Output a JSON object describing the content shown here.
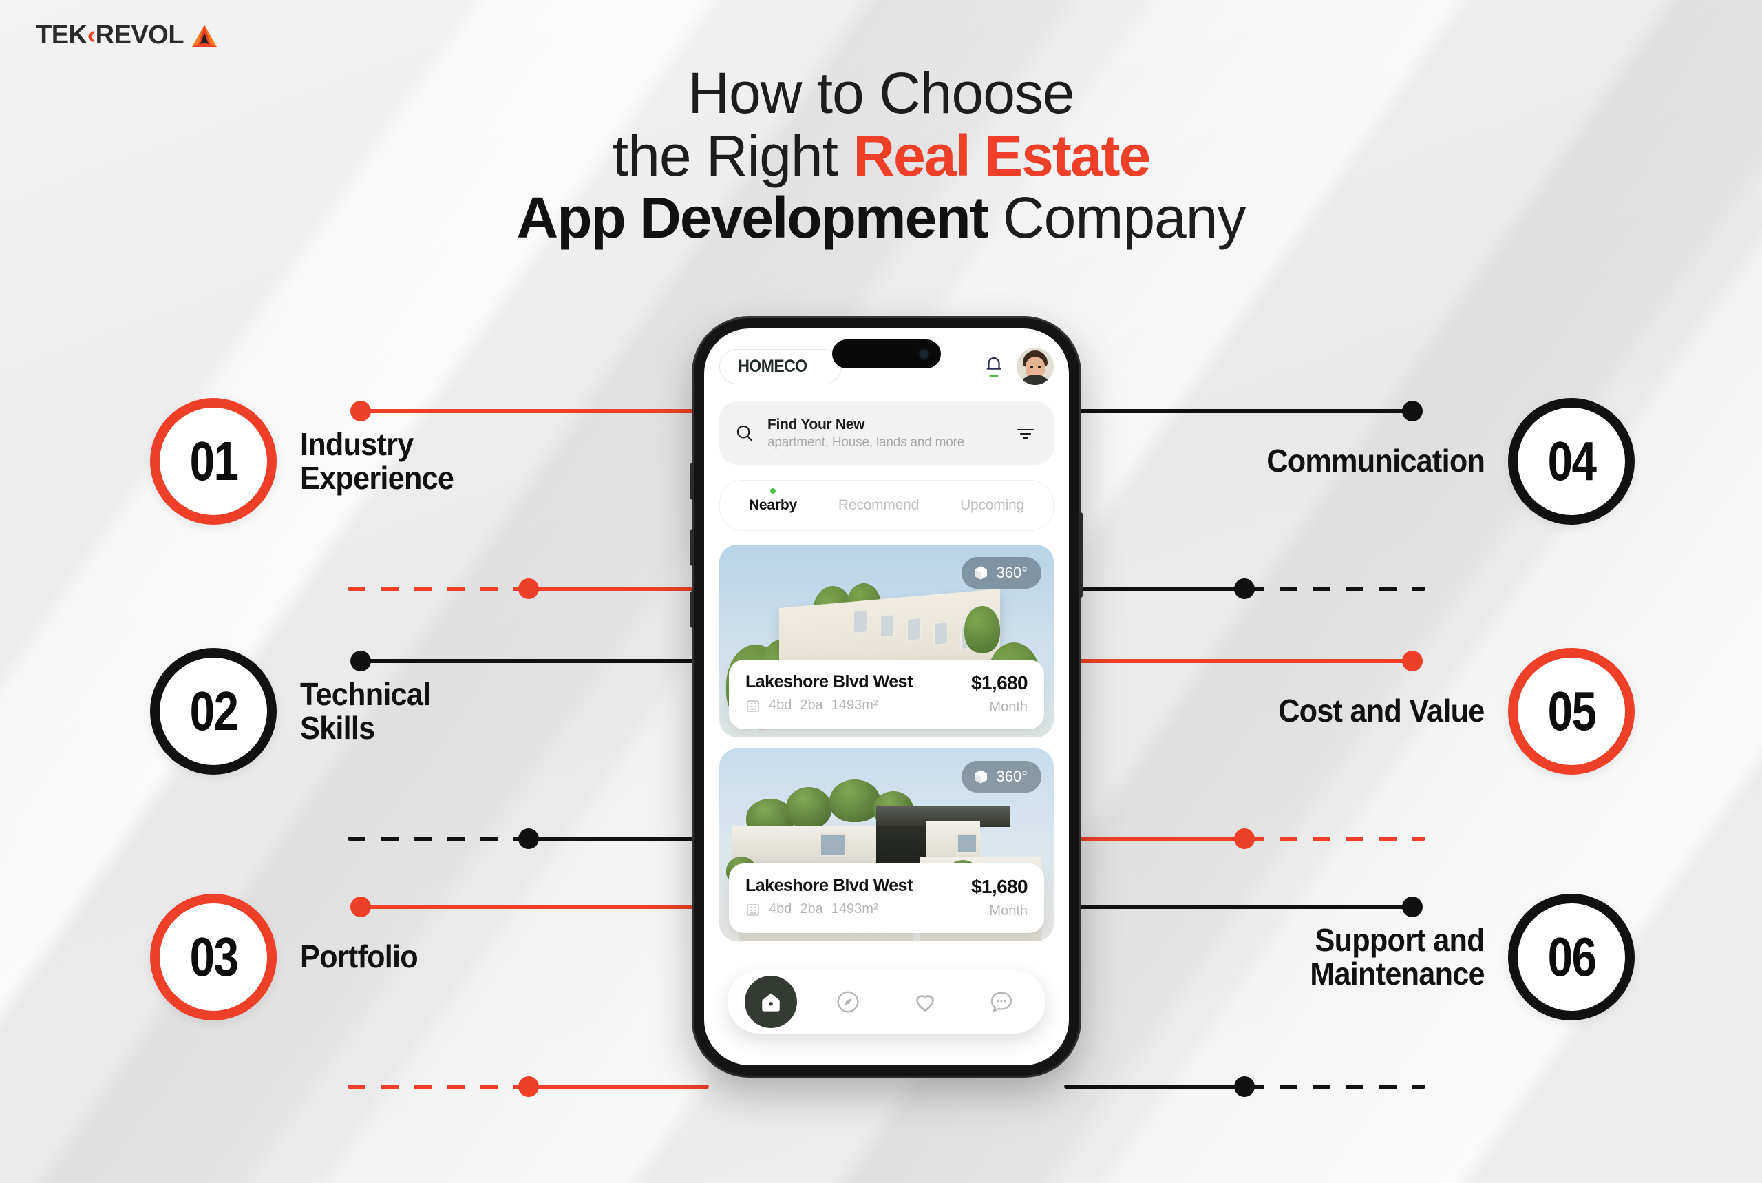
{
  "brand": {
    "logo_text_1": "TEK",
    "logo_chevron": "‹",
    "logo_text_2": "REVOL",
    "logo_icon": "tekrevol-triangle-logo"
  },
  "headline": {
    "line1": "How to Choose",
    "line2_plain": "the Right ",
    "line2_accent": "Real Estate",
    "line3_bold": "App Development",
    "line3_plain": " Company"
  },
  "colors": {
    "accent_red": "#EE4028",
    "dark": "#111111",
    "background": "#ECECEC",
    "nav_active": "#333B33",
    "status_green": "#4FC24F"
  },
  "items": [
    {
      "number": "01",
      "label": "Industry\nExperience",
      "color": "red",
      "side": "left"
    },
    {
      "number": "02",
      "label": "Technical\nSkills",
      "color": "black",
      "side": "left"
    },
    {
      "number": "03",
      "label": "Portfolio",
      "color": "red",
      "side": "left"
    },
    {
      "number": "04",
      "label": "Communication",
      "color": "black",
      "side": "right"
    },
    {
      "number": "05",
      "label": "Cost and Value",
      "color": "red",
      "side": "right"
    },
    {
      "number": "06",
      "label": "Support and\nMaintenance",
      "color": "black",
      "side": "right"
    }
  ],
  "phone": {
    "app": {
      "brand_name": "HOMECO",
      "icons": {
        "bell": "bell-icon",
        "avatar": "user-avatar",
        "search": "search-icon",
        "filter": "filter-icon"
      },
      "search": {
        "title": "Find Your New",
        "placeholder": "apartment, House, lands and more"
      },
      "tabs": [
        {
          "label": "Nearby",
          "active": true
        },
        {
          "label": "Recommend",
          "active": false
        },
        {
          "label": "Upcoming",
          "active": false
        }
      ],
      "cards": [
        {
          "badge": "360°",
          "title": "Lakeshore Blvd West",
          "beds": "4bd",
          "baths": "2ba",
          "area": "1493m²",
          "price": "$1,680",
          "period": "Month"
        },
        {
          "badge": "360°",
          "title": "Lakeshore Blvd West",
          "beds": "4bd",
          "baths": "2ba",
          "area": "1493m²",
          "price": "$1,680",
          "period": "Month"
        }
      ],
      "bottom_nav": [
        {
          "icon": "home-icon",
          "active": true
        },
        {
          "icon": "explore-icon",
          "active": false
        },
        {
          "icon": "heart-icon",
          "active": false
        },
        {
          "icon": "chat-icon",
          "active": false
        }
      ]
    }
  }
}
